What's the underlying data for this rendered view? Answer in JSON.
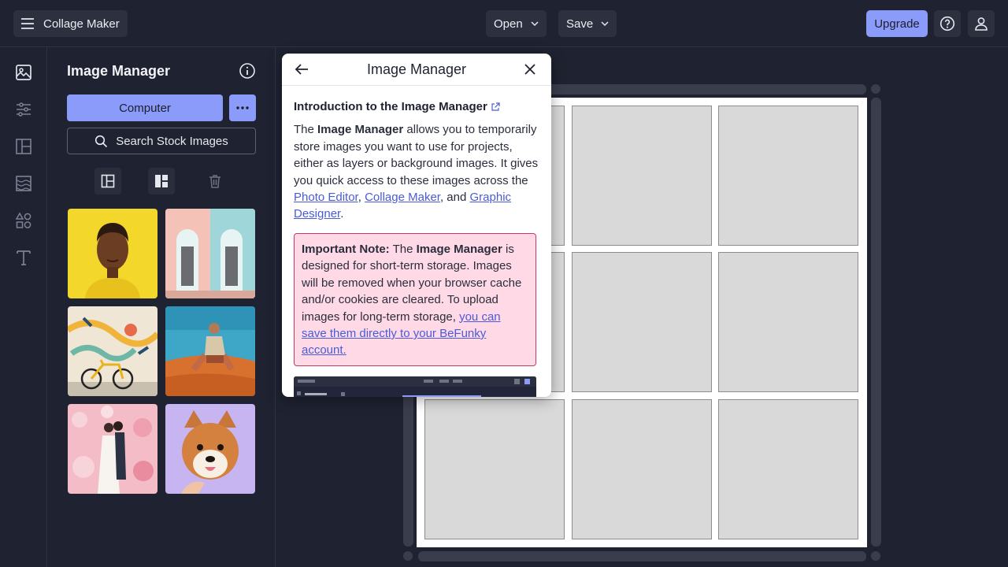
{
  "app": {
    "menu_label": "Collage Maker",
    "open_label": "Open",
    "save_label": "Save",
    "upgrade_label": "Upgrade",
    "accent_color": "#8b9bfa"
  },
  "rail": {
    "items": [
      "image-manager-icon",
      "adjust-icon",
      "layouts-icon",
      "backgrounds-icon",
      "graphics-icon",
      "text-icon"
    ]
  },
  "panel": {
    "title": "Image Manager",
    "computer_label": "Computer",
    "stock_label": "Search Stock Images",
    "tools": [
      "autofill-icon",
      "layout-fill-icon",
      "trash-icon"
    ]
  },
  "popup": {
    "title": "Image Manager",
    "intro_link": "Introduction to the Image Manager",
    "p_the": "The ",
    "p_im": "Image Manager",
    "p_rest": " allows you to temporarily store images you want to use for projects, either as layers or background images. It gives you quick access to these images across the ",
    "link_photo_editor": "Photo Editor",
    "comma": ", ",
    "link_collage_maker": "Collage Maker",
    "and_text": ", and ",
    "link_graphic_designer": "Graphic Designer",
    "period": ".",
    "note_bold": "Important Note:",
    "note_the": " The ",
    "note_im": "Image Manager",
    "note_rest": " is designed for short-term storage. Images will be removed when your browser cache and/or cookies are cleared. To upload images for long-term storage, ",
    "note_link": "you can save them directly to your BeFunky account."
  }
}
